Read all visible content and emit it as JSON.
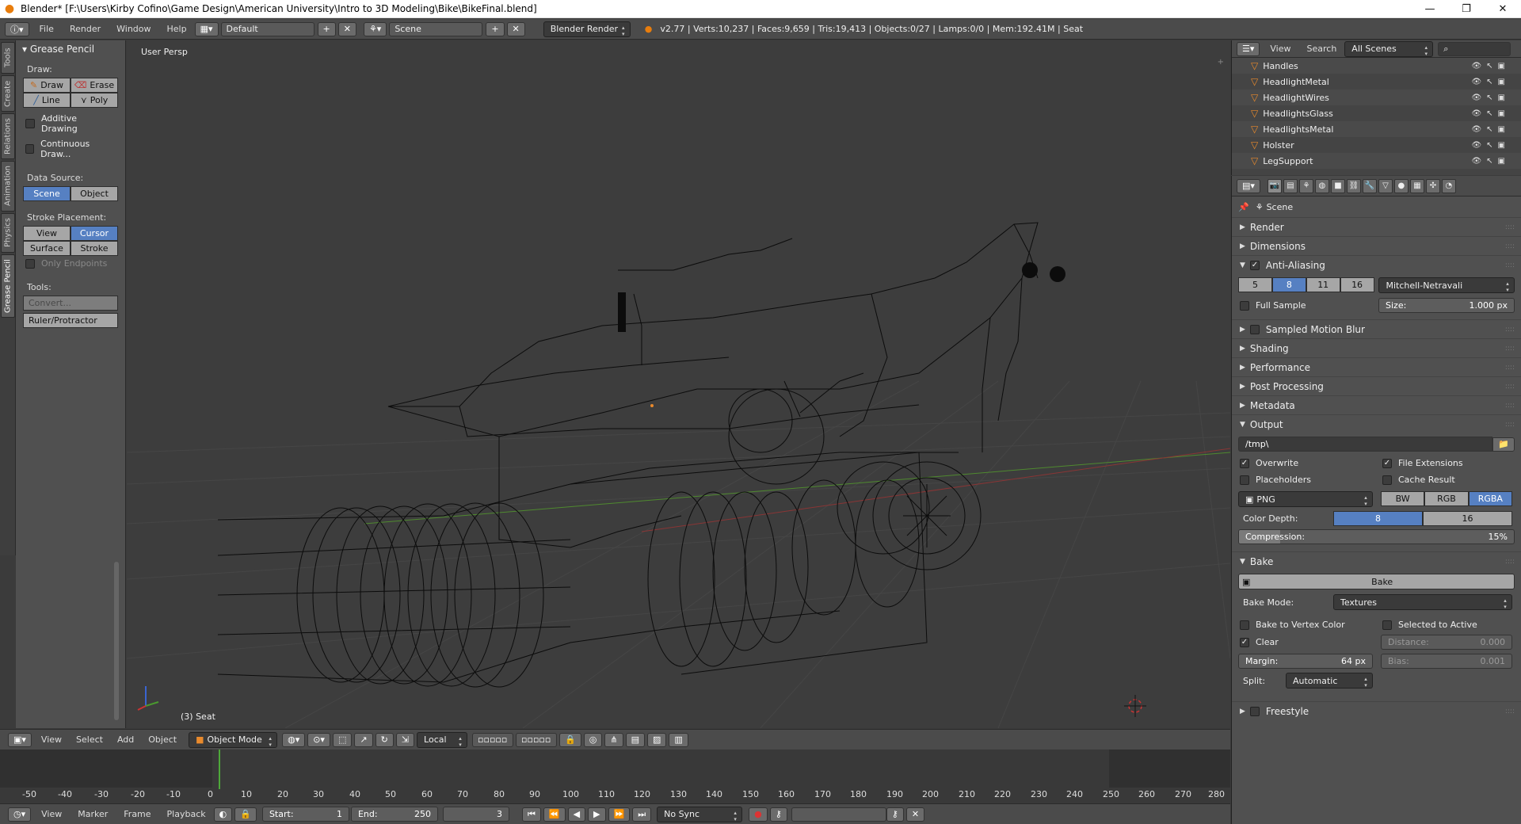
{
  "window": {
    "title": "Blender* [F:\\Users\\Kirby Cofino\\Game Design\\American University\\Intro to 3D Modeling\\Bike\\BikeFinal.blend]",
    "minimize": "—",
    "maximize": "❐",
    "close": "✕"
  },
  "infobar": {
    "menus": [
      "File",
      "Render",
      "Window",
      "Help"
    ],
    "layout": "Default",
    "scene": "Scene",
    "engine": "Blender Render",
    "stats": "v2.77 | Verts:10,237 | Faces:9,659 | Tris:19,413 | Objects:0/27 | Lamps:0/0 | Mem:192.41M | Seat"
  },
  "left_tabs": [
    "Tools",
    "Create",
    "Relations",
    "Animation",
    "Physics",
    "Grease Pencil"
  ],
  "toolshelf": {
    "panel_title": "Grease Pencil",
    "draw_label": "Draw:",
    "draw": "Draw",
    "erase": "Erase",
    "line": "Line",
    "poly": "Poly",
    "additive_drawing": "Additive Drawing",
    "continuous_draw": "Continuous Draw...",
    "data_source_label": "Data Source:",
    "scene": "Scene",
    "object": "Object",
    "stroke_placement_label": "Stroke Placement:",
    "view": "View",
    "cursor": "Cursor",
    "surface": "Surface",
    "stroke": "Stroke",
    "only_endpoints": "Only Endpoints",
    "tools_label": "Tools:",
    "convert": "Convert...",
    "ruler": "Ruler/Protractor"
  },
  "viewport": {
    "perspective": "User Persp",
    "object_label": "(3) Seat"
  },
  "view3d_header": {
    "menus": [
      "View",
      "Select",
      "Add",
      "Object"
    ],
    "mode": "Object Mode",
    "orientation": "Local"
  },
  "timeline": {
    "ruler": [
      "-50",
      "-40",
      "-30",
      "-20",
      "-10",
      "0",
      "10",
      "20",
      "30",
      "40",
      "50",
      "60",
      "70",
      "80",
      "90",
      "100",
      "110",
      "120",
      "130",
      "140",
      "150",
      "160",
      "170",
      "180",
      "190",
      "200",
      "210",
      "220",
      "230",
      "240",
      "250",
      "260",
      "270",
      "280"
    ],
    "menus": [
      "View",
      "Marker",
      "Frame",
      "Playback"
    ],
    "start_label": "Start:",
    "start": "1",
    "end_label": "End:",
    "end": "250",
    "current": "3",
    "sync": "No Sync"
  },
  "outliner": {
    "view": "View",
    "search": "Search",
    "scenes": "All Scenes",
    "items": [
      "Handles",
      "HeadlightMetal",
      "HeadlightWires",
      "HeadlightsGlass",
      "HeadlightsMetal",
      "Holster",
      "LegSupport"
    ]
  },
  "properties": {
    "context": "Scene",
    "sections": {
      "render": "Render",
      "dimensions": "Dimensions",
      "anti_aliasing": "Anti-Aliasing",
      "sampled_motion_blur": "Sampled Motion Blur",
      "shading": "Shading",
      "performance": "Performance",
      "post_processing": "Post Processing",
      "metadata": "Metadata",
      "output": "Output",
      "bake": "Bake",
      "freestyle": "Freestyle"
    },
    "aa_samples": [
      "5",
      "8",
      "11",
      "16"
    ],
    "aa_filter": "Mitchell-Netravali",
    "full_sample": "Full Sample",
    "size_label": "Size:",
    "size": "1.000 px",
    "output_path": "/tmp\\",
    "overwrite": "Overwrite",
    "file_extensions": "File Extensions",
    "placeholders": "Placeholders",
    "cache_result": "Cache Result",
    "format": "PNG",
    "color_modes": [
      "BW",
      "RGB",
      "RGBA"
    ],
    "color_depth_label": "Color Depth:",
    "color_depths": [
      "8",
      "16"
    ],
    "compression_label": "Compression:",
    "compression": "15%",
    "compression_value": 0.15,
    "bake_button": "Bake",
    "bake_mode_label": "Bake Mode:",
    "bake_mode": "Textures",
    "bake_to_vertex_color": "Bake to Vertex Color",
    "selected_to_active": "Selected to Active",
    "clear": "Clear",
    "distance_label": "Distance:",
    "distance": "0.000",
    "margin_label": "Margin:",
    "margin": "64 px",
    "bias_label": "Bias:",
    "bias": "0.001",
    "split_label": "Split:",
    "split": "Automatic"
  },
  "colors": {
    "selected": "#5680c2",
    "object_orange": "#e98a2c"
  }
}
